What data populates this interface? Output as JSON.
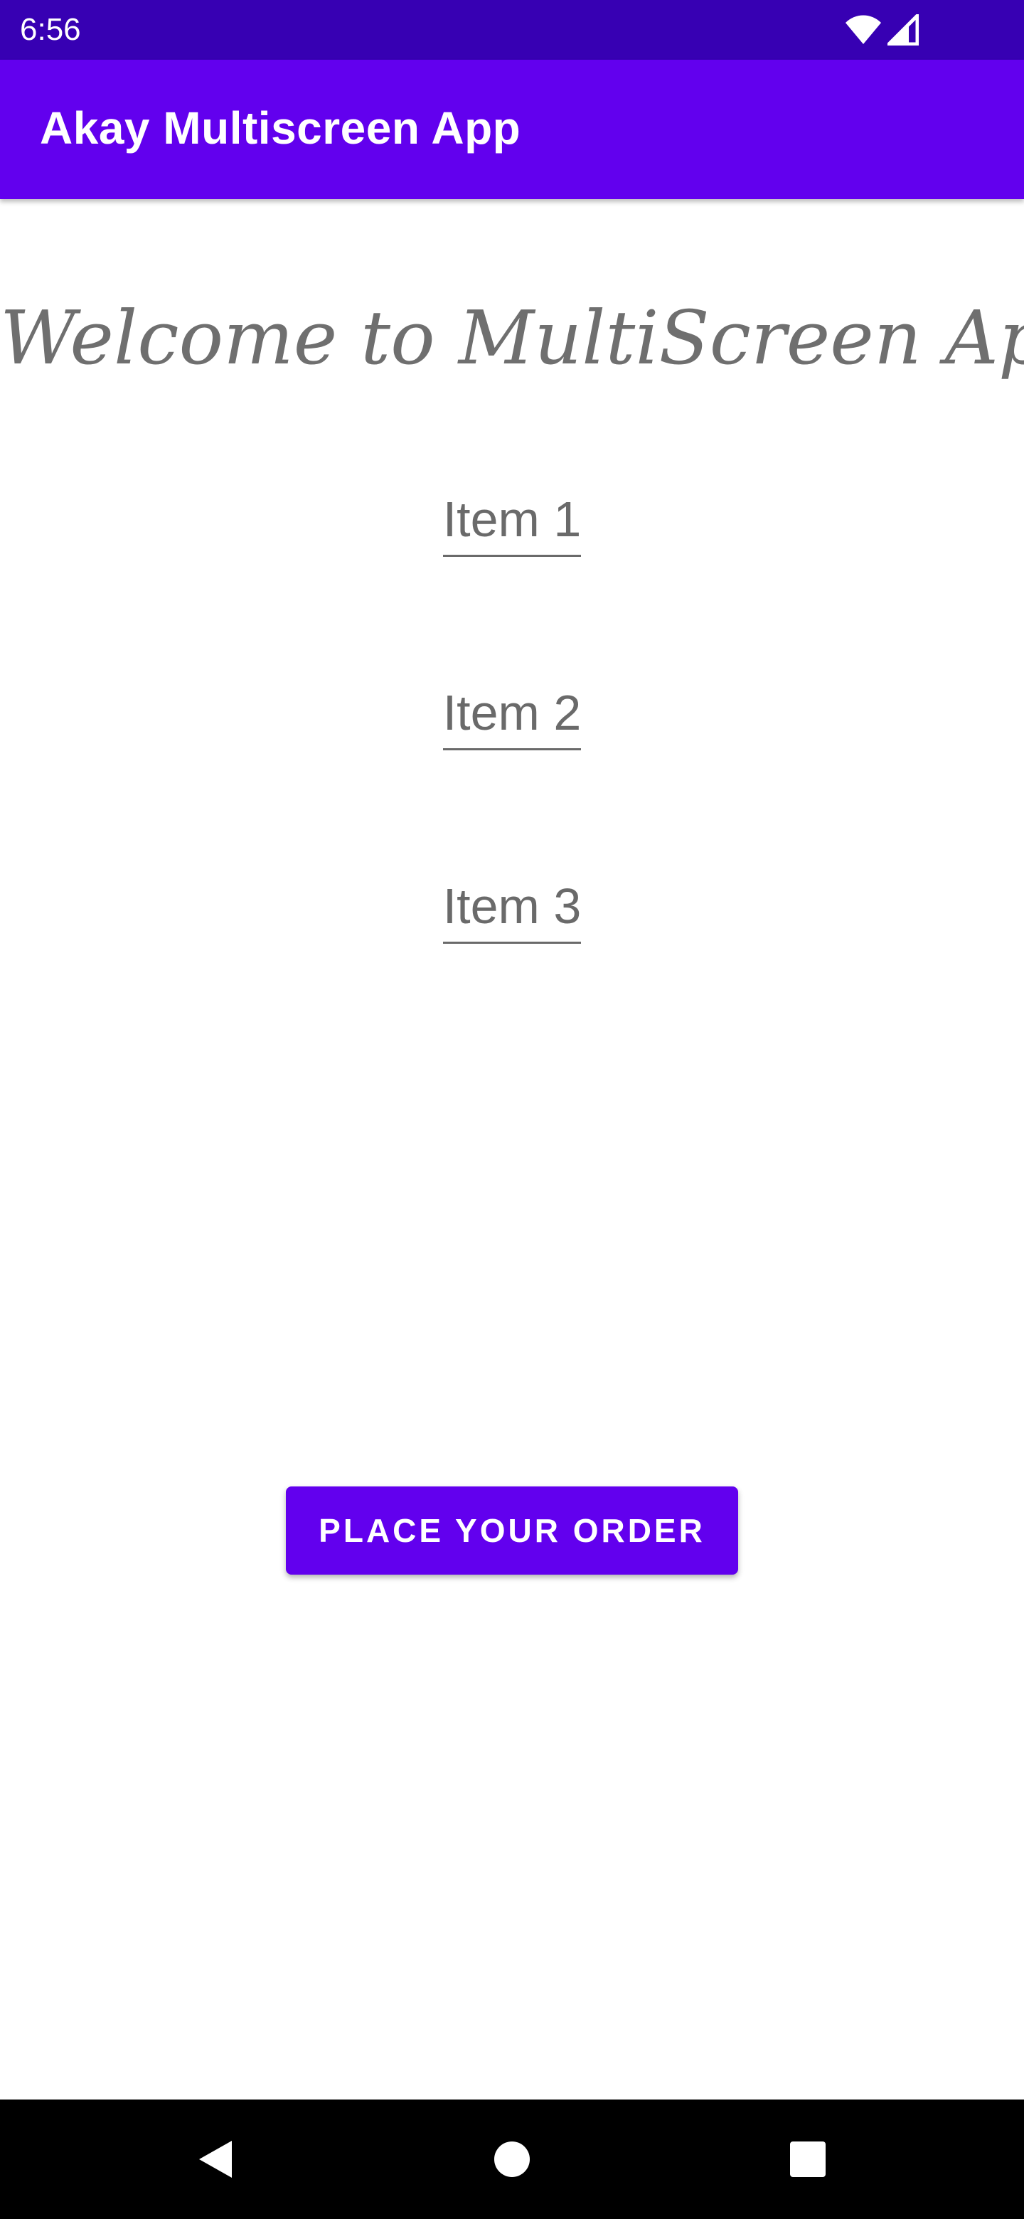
{
  "status_bar": {
    "time": "6:56",
    "icons": [
      "wifi-icon",
      "cell-signal-icon"
    ],
    "color": "#3700b3"
  },
  "app_bar": {
    "title": "Akay Multiscreen App",
    "color": "#6200ee"
  },
  "main": {
    "welcome_text": "Welcome to MultiScreen App",
    "items": [
      {
        "label": "Item 1"
      },
      {
        "label": "Item 2"
      },
      {
        "label": "Item 3"
      }
    ],
    "order_button_label": "PLACE YOUR ORDER"
  },
  "nav_bar": {
    "buttons": [
      "back-icon",
      "home-icon",
      "recents-icon"
    ]
  }
}
